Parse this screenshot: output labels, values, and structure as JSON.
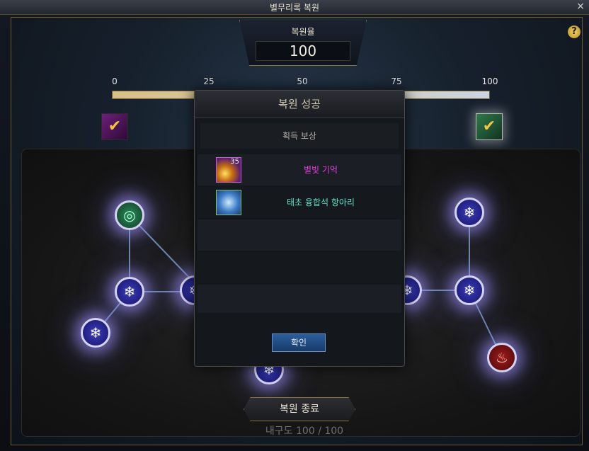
{
  "window": {
    "title": "별무리록 복원",
    "close_glyph": "×"
  },
  "header": {
    "rate_label": "복원율",
    "rate_value": "100",
    "help_glyph": "?"
  },
  "progress": {
    "ticks": [
      "0",
      "25",
      "50",
      "75",
      "100"
    ],
    "fill_fraction": 1.0
  },
  "modal": {
    "title": "복원 성공",
    "subtitle": "획득 보상",
    "items": [
      {
        "name": "별빛 기억",
        "count": "35",
        "color": "#e040e0",
        "icon": "starlight-memory-icon"
      },
      {
        "name": "태초 융합석 항아리",
        "color": "#5de0c8",
        "icon": "fusion-stone-jar-icon"
      }
    ],
    "confirm_label": "확인"
  },
  "footer": {
    "end_label": "복원 종료",
    "durability_label": "내구도",
    "durability_value": "100",
    "durability_sep": "/",
    "durability_max": "100"
  },
  "colors": {
    "accent_gold": "#8a7344",
    "confirm_blue": "#2d5e9c",
    "node_glow": "#a096ff"
  }
}
